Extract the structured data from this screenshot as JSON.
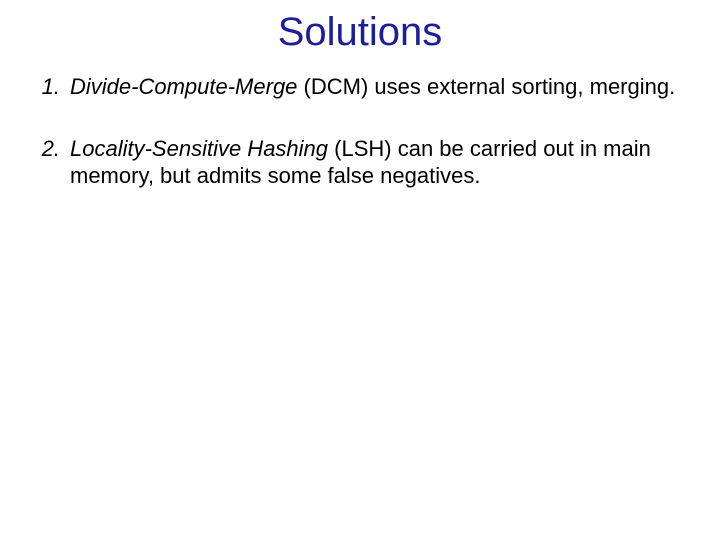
{
  "title": "Solutions",
  "items": [
    {
      "num": "1.",
      "term": "Divide-Compute-Merge",
      "rest": " (DCM) uses external sorting, merging."
    },
    {
      "num": "2.",
      "term": "Locality-Sensitive Hashing",
      "rest": " (LSH) can be carried out in main memory, but admits some false negatives."
    }
  ]
}
